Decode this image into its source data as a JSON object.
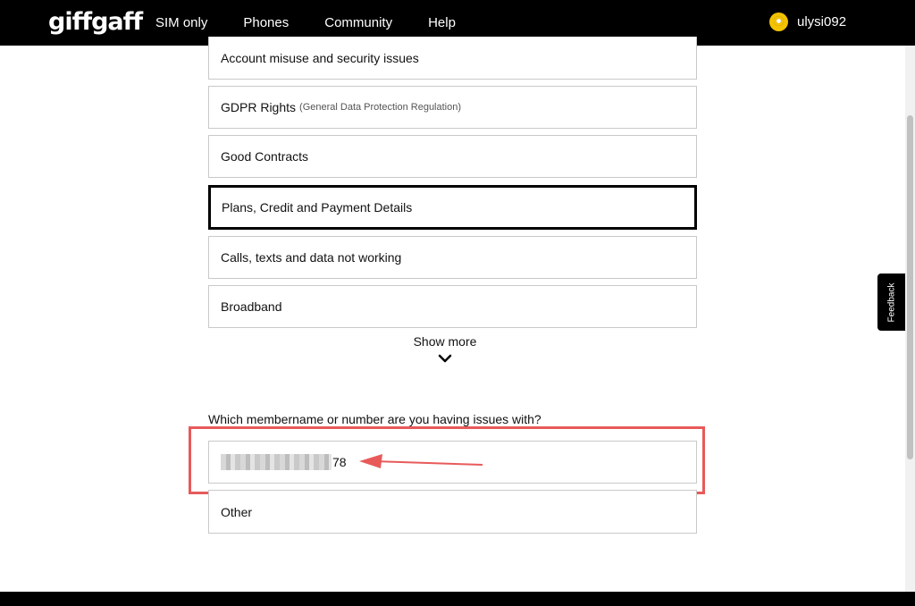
{
  "header": {
    "logo": "giffgaff",
    "nav": [
      "SIM only",
      "Phones",
      "Community",
      "Help"
    ],
    "username": "ulysi092"
  },
  "options": {
    "account": "Account misuse and security issues",
    "gdpr": "GDPR Rights",
    "gdpr_note": "(General Data Protection Regulation)",
    "contracts": "Good Contracts",
    "plans": "Plans, Credit and Payment Details",
    "calls": "Calls, texts and data not working",
    "broadband": "Broadband",
    "show_more": "Show more"
  },
  "member_question": {
    "label": "Which membername or number are you having issues with?",
    "number_suffix": "78",
    "other": "Other"
  },
  "feedback": "Feedback",
  "colors": {
    "header": "#000000",
    "highlight": "#e85a5a"
  }
}
